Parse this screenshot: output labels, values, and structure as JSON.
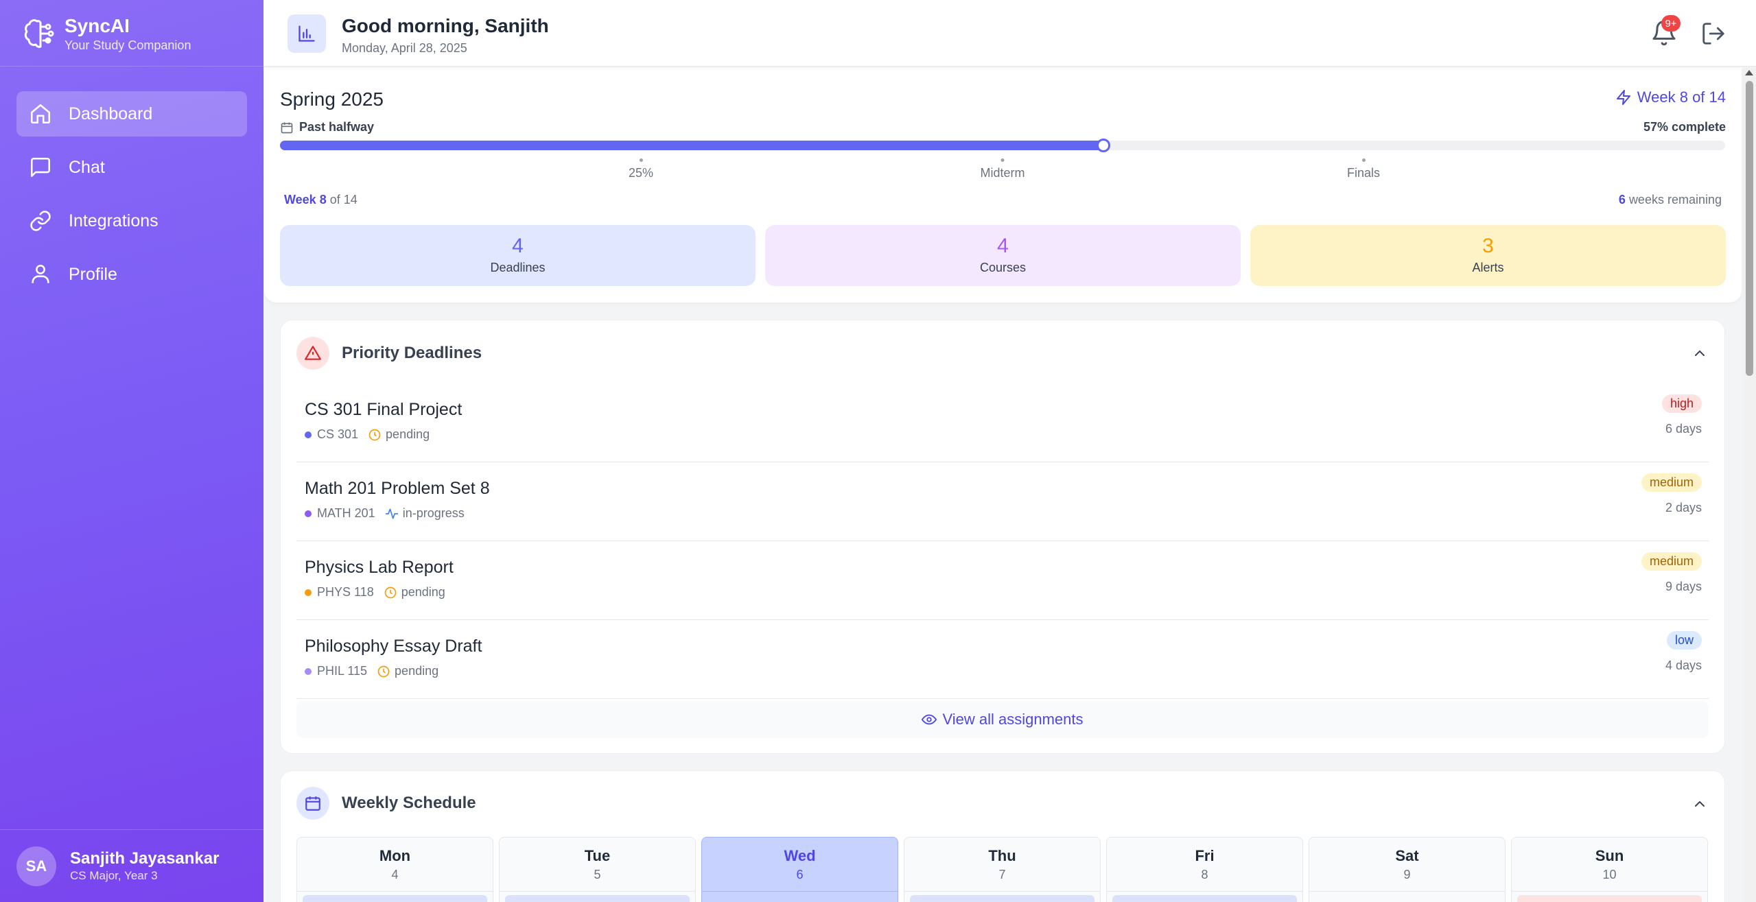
{
  "app": {
    "name": "SyncAI",
    "tagline": "Your Study Companion"
  },
  "sidebar": {
    "items": [
      {
        "label": "Dashboard",
        "icon": "home-icon",
        "active": true
      },
      {
        "label": "Chat",
        "icon": "chat-icon"
      },
      {
        "label": "Integrations",
        "icon": "link-icon"
      },
      {
        "label": "Profile",
        "icon": "user-icon"
      }
    ],
    "user": {
      "initials": "SA",
      "name": "Sanjith Jayasankar",
      "role": "CS Major, Year 3"
    }
  },
  "header": {
    "greeting": "Good morning, Sanjith",
    "date": "Monday, April 28, 2025",
    "notification_badge": "9+"
  },
  "semester": {
    "title": "Spring 2025",
    "week_label": "Week 8 of 14",
    "status": "Past halfway",
    "complete_label": "57% complete",
    "progress_percent": 57,
    "milestones": [
      "25%",
      "Midterm",
      "Finals"
    ],
    "week_current": "Week 8",
    "week_total_suffix": "of 14",
    "weeks_remaining_num": "6",
    "weeks_remaining_suffix": "weeks remaining",
    "stats": [
      {
        "value": "4",
        "label": "Deadlines",
        "color": "#6366f1",
        "bg": "#e0e7ff"
      },
      {
        "value": "4",
        "label": "Courses",
        "color": "#a855f7",
        "bg": "#f3e8ff"
      },
      {
        "value": "3",
        "label": "Alerts",
        "color": "#f59e0b",
        "bg": "#fef3c7"
      }
    ]
  },
  "deadlines": {
    "title": "Priority Deadlines",
    "items": [
      {
        "title": "CS 301 Final Project",
        "course": "CS 301",
        "course_color": "#6366f1",
        "status": "pending",
        "status_icon": "clock-icon",
        "priority": "high",
        "days": "6 days"
      },
      {
        "title": "Math 201 Problem Set 8",
        "course": "MATH 201",
        "course_color": "#8b5cf6",
        "status": "in-progress",
        "status_icon": "activity-icon",
        "priority": "medium",
        "days": "2 days"
      },
      {
        "title": "Physics Lab Report",
        "course": "PHYS 118",
        "course_color": "#f59e0b",
        "status": "pending",
        "status_icon": "clock-icon",
        "priority": "medium",
        "days": "9 days"
      },
      {
        "title": "Philosophy Essay Draft",
        "course": "PHIL 115",
        "course_color": "#a78bfa",
        "status": "pending",
        "status_icon": "clock-icon",
        "priority": "low",
        "days": "4 days"
      }
    ],
    "view_all": "View all assignments"
  },
  "schedule": {
    "title": "Weekly Schedule",
    "days": [
      {
        "name": "Mon",
        "num": "4"
      },
      {
        "name": "Tue",
        "num": "5"
      },
      {
        "name": "Wed",
        "num": "6",
        "today": true
      },
      {
        "name": "Thu",
        "num": "7"
      },
      {
        "name": "Fri",
        "num": "8"
      },
      {
        "name": "Sat",
        "num": "9"
      },
      {
        "name": "Sun",
        "num": "10"
      }
    ]
  }
}
